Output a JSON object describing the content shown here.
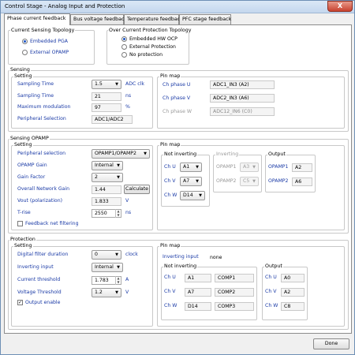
{
  "window": {
    "title": "Control Stage - Analog Input and Protection",
    "close": "X"
  },
  "tabs": [
    {
      "label": "Phase current feedback"
    },
    {
      "label": "Bus voltage feedback"
    },
    {
      "label": "Temperature feedback"
    },
    {
      "label": "PFC stage feedback"
    }
  ],
  "topology": {
    "title": "Current Sensing Topology",
    "options": [
      "Embedded PGA",
      "External OPAMP"
    ]
  },
  "ocp": {
    "title": "Over Current Protection Topology",
    "options": [
      "Embedded HW OCP",
      "External Protection",
      "No protection"
    ]
  },
  "sensing": {
    "title": "Sensing",
    "setting": "Setting",
    "sampling_time_label": "Sampling Time",
    "sampling_time_value": "1.5",
    "sampling_time_unit": "ADC clk",
    "sampling_time2_label": "Sampling Time",
    "sampling_time2_value": "21",
    "sampling_time2_unit": "ns",
    "max_mod_label": "Maximum modulation",
    "max_mod_value": "97",
    "max_mod_unit": "%",
    "periph_label": "Peripheral Selection",
    "periph_value": "ADC1/ADC2",
    "pinmap": "Pin map",
    "ch_u_label": "Ch phase U",
    "ch_u_value": "ADC1_IN3 (A2)",
    "ch_v_label": "Ch phase V",
    "ch_v_value": "ADC2_IN3 (A6)",
    "ch_w_label": "Ch phase W",
    "ch_w_value": "ADC12_IN6 (C0)"
  },
  "opamp": {
    "title": "Sensing OPAMP",
    "setting": "Setting",
    "periph_label": "Peripheral selection",
    "periph_value": "OPAMP1/OPAMP2",
    "gain_label": "OPAMP Gain",
    "gain_value": "Internal",
    "gain_factor_label": "Gain Factor",
    "gain_factor_value": "2",
    "overall_label": "Overall Network Gain",
    "overall_value": "1.44",
    "calculate": "Calculate",
    "vout_label": "Vout (polarization)",
    "vout_value": "1.833",
    "vout_unit": "V",
    "trise_label": "T-rise",
    "trise_value": "2550",
    "trise_unit": "ns",
    "feedback_label": "Feedback net filtering",
    "pinmap": "Pin map",
    "not_inverting": "Not inverting",
    "inverting": "Inverting",
    "output": "Output",
    "ch_u": "Ch U",
    "ch_u_value": "A1",
    "ch_v": "Ch V",
    "ch_v_value": "A7",
    "ch_w": "Ch W",
    "ch_w_value": "D14",
    "opamp1": "OPAMP1",
    "opamp1_value": "A3",
    "opamp2": "OPAMP2",
    "opamp2_value": "C5",
    "out1": "OPAMP1",
    "out1_value": "A2",
    "out2": "OPAMP2",
    "out2_value": "A6"
  },
  "protection": {
    "title": "Protection",
    "setting": "Setting",
    "filter_label": "Digital filter duration",
    "filter_value": "0",
    "filter_unit": "clock",
    "inv_label": "Inverting input",
    "inv_value": "Internal",
    "cur_label": "Current threshold",
    "cur_value": "1.783",
    "cur_unit": "A",
    "volt_label": "Voltage Threshold",
    "volt_value": "1.2",
    "volt_unit": "V",
    "output_enable": "Output enable",
    "pinmap": "Pin map",
    "inv_input_label": "Inverting input",
    "inv_input_value": "none",
    "not_inverting": "Not inverting",
    "output": "Output",
    "ch_u": "Ch U",
    "u_pin": "A1",
    "u_comp": "COMP1",
    "ch_v": "Ch V",
    "v_pin": "A7",
    "v_comp": "COMP2",
    "ch_w": "Ch W",
    "w_pin": "D14",
    "w_comp": "COMP3",
    "out_u": "Ch U",
    "out_u_value": "A0",
    "out_v": "Ch V",
    "out_v_value": "A2",
    "out_w": "Ch W",
    "out_w_value": "C8"
  },
  "footer": {
    "done": "Done"
  }
}
